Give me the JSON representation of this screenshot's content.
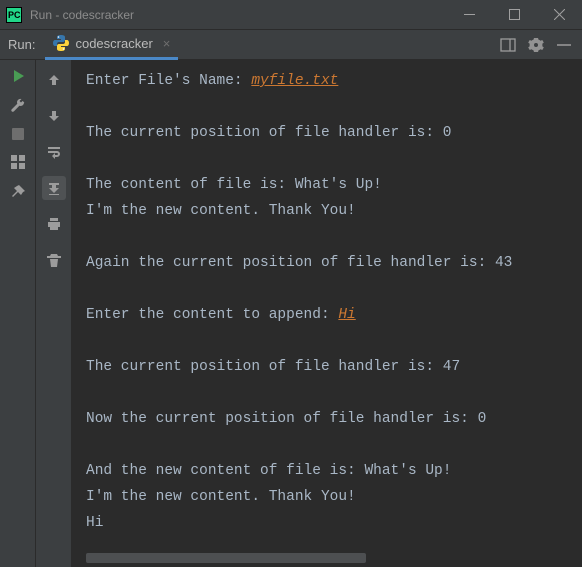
{
  "window": {
    "title": "Run - codescracker",
    "app_icon_text": "PC"
  },
  "toolbar": {
    "run_label": "Run:",
    "tab_label": "codescracker"
  },
  "console": {
    "lines": [
      {
        "prompt": "Enter File's Name: ",
        "input": "myfile.txt"
      },
      {
        "text": ""
      },
      {
        "text": "The current position of file handler is: 0"
      },
      {
        "text": ""
      },
      {
        "text": "The content of file is: What's Up!"
      },
      {
        "text": "I'm the new content. Thank You!"
      },
      {
        "text": ""
      },
      {
        "text": "Again the current position of file handler is: 43"
      },
      {
        "text": ""
      },
      {
        "prompt": "Enter the content to append: ",
        "input": "Hi"
      },
      {
        "text": ""
      },
      {
        "text": "The current position of file handler is: 47"
      },
      {
        "text": ""
      },
      {
        "text": "Now the current position of file handler is: 0"
      },
      {
        "text": ""
      },
      {
        "text": "And the new content of file is: What's Up!"
      },
      {
        "text": "I'm the new content. Thank You!"
      },
      {
        "text": "Hi"
      }
    ]
  }
}
